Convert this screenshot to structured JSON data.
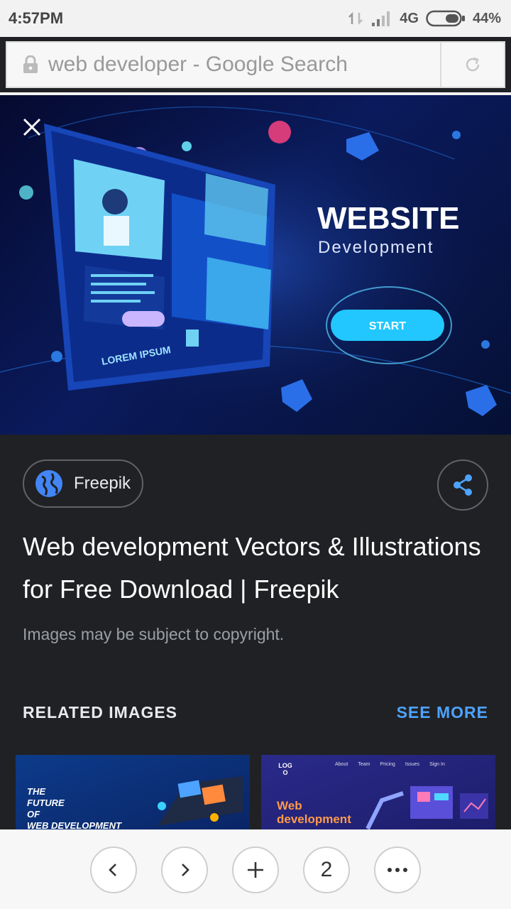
{
  "status_bar": {
    "time": "4:57PM",
    "network": "4G",
    "battery": "44%"
  },
  "url_bar": {
    "text": "web developer - Google Search"
  },
  "hero": {
    "title": "WEBSITE",
    "subtitle": "Development",
    "button_label": "START",
    "screen_label": "LOREM IPSUM"
  },
  "result": {
    "source": "Freepik",
    "title": "Web development Vectors & Illustrations for Free Download | Freepik",
    "notice": "Images may be subject to copyright."
  },
  "related": {
    "label": "RELATED IMAGES",
    "see_more": "SEE MORE",
    "thumb1": {
      "lines": [
        "THE",
        "FUTURE",
        "OF",
        "WEB DEVELOPMENT"
      ]
    },
    "thumb2": {
      "logo": "LOGO",
      "line1": "Web",
      "line2": "development",
      "nav": [
        "About",
        "Team",
        "Pricing",
        "Issues",
        "Sign In"
      ]
    }
  },
  "bottom_nav": {
    "tabs_count": "2"
  },
  "colors": {
    "accent": "#4da3ff",
    "background": "#202124",
    "chrome": "#f2f2f2"
  }
}
